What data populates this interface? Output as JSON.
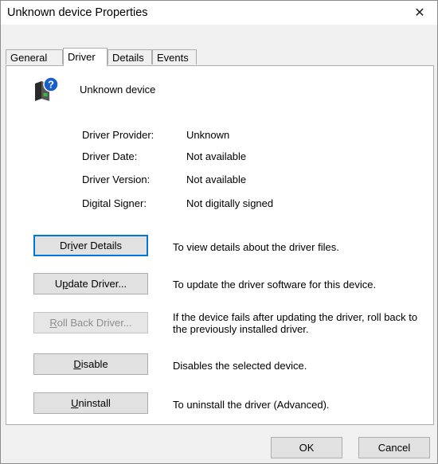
{
  "window": {
    "title": "Unknown device Properties",
    "close_glyph": "✕"
  },
  "tabs": [
    {
      "label": "General",
      "active": false
    },
    {
      "label": "Driver",
      "active": true
    },
    {
      "label": "Details",
      "active": false
    },
    {
      "label": "Events",
      "active": false
    }
  ],
  "device": {
    "name": "Unknown device",
    "icon": "unknown-device-icon"
  },
  "driver_info": [
    {
      "label": "Driver Provider:",
      "value": "Unknown"
    },
    {
      "label": "Driver Date:",
      "value": "Not available"
    },
    {
      "label": "Driver Version:",
      "value": "Not available"
    },
    {
      "label": "Digital Signer:",
      "value": "Not digitally signed"
    }
  ],
  "actions": [
    {
      "pre": "Dr",
      "key": "i",
      "post": "ver Details",
      "description": "To view details about the driver files.",
      "enabled": true,
      "focused": true
    },
    {
      "pre": "U",
      "key": "p",
      "post": "date Driver...",
      "description": "To update the driver software for this device.",
      "enabled": true,
      "focused": false
    },
    {
      "pre": "",
      "key": "R",
      "post": "oll Back Driver...",
      "description": "If the device fails after updating the driver, roll back to the previously installed driver.",
      "enabled": false,
      "focused": false
    },
    {
      "pre": "",
      "key": "D",
      "post": "isable",
      "description": "Disables the selected device.",
      "enabled": true,
      "focused": false
    },
    {
      "pre": "",
      "key": "U",
      "post": "ninstall",
      "description": "To uninstall the driver (Advanced).",
      "enabled": true,
      "focused": false
    }
  ],
  "footer": {
    "ok_label": "OK",
    "cancel_label": "Cancel"
  },
  "colors": {
    "focus_border": "#0078d7",
    "button_face": "#e1e1e1",
    "disabled_text": "#8d8d8d"
  }
}
